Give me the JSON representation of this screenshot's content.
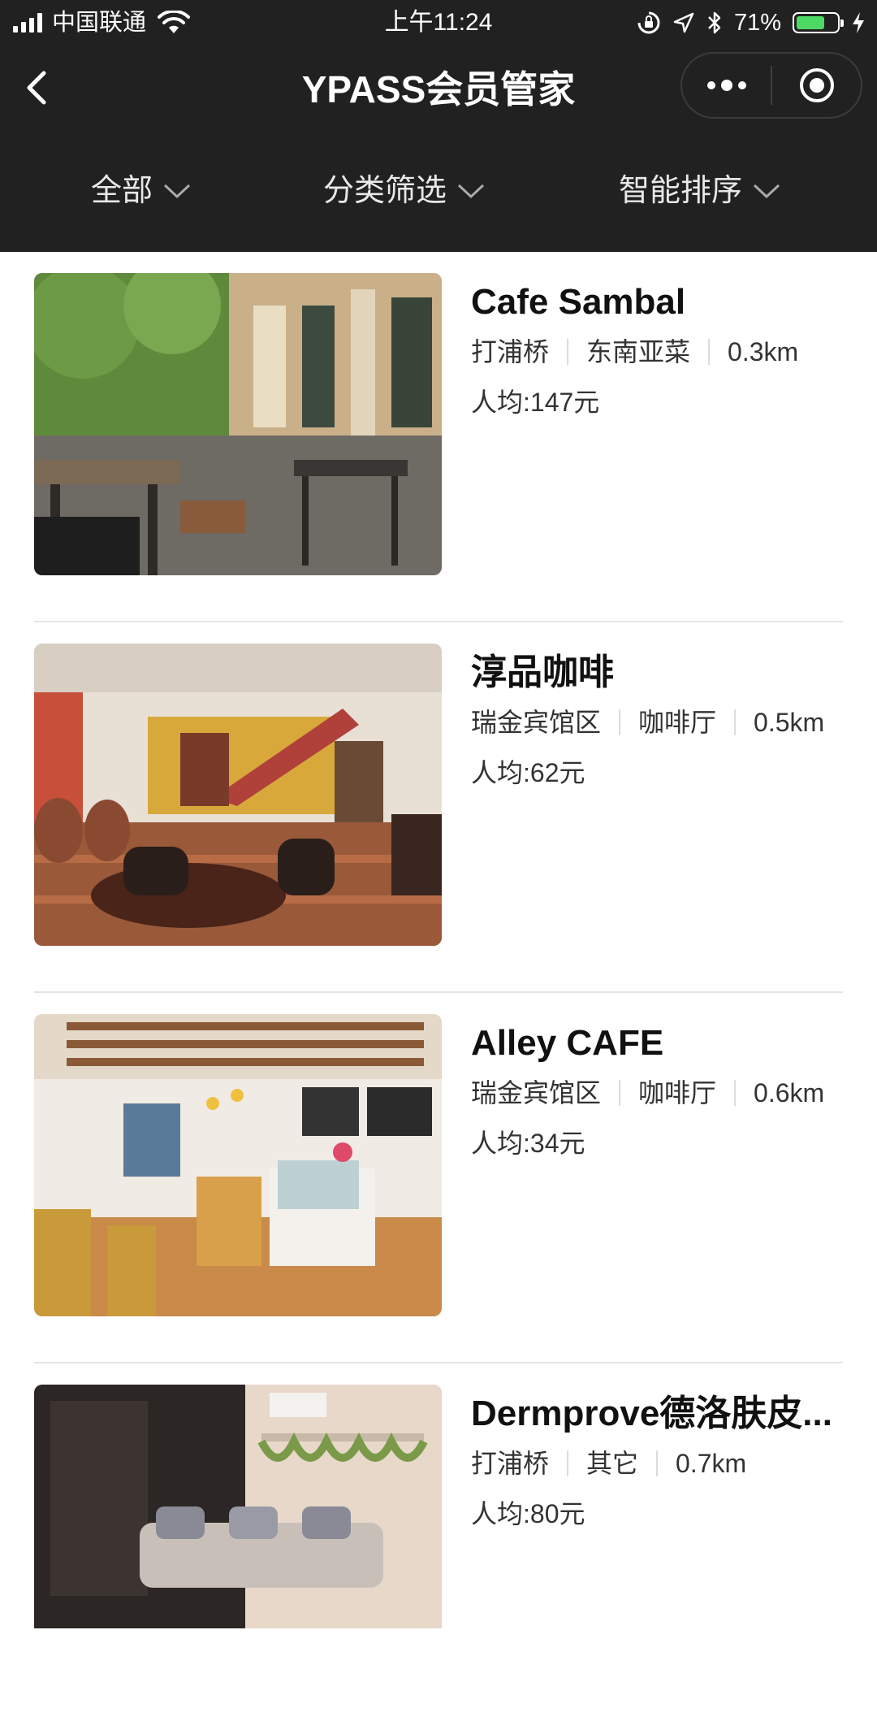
{
  "status": {
    "carrier": "中国联通",
    "time": "上午11:24",
    "battery_text": "71%",
    "battery_level": 0.71,
    "battery_color": "#4cd964"
  },
  "nav": {
    "back_icon": "chevron-left-icon",
    "title": "YPASS会员管家",
    "more_icon": "more-dots-icon",
    "close_icon": "target-circle-icon"
  },
  "filters": [
    {
      "label": "全部"
    },
    {
      "label": "分类筛选"
    },
    {
      "label": "智能排序"
    }
  ],
  "shops": [
    {
      "name": "Cafe Sambal",
      "area": "打浦桥",
      "category": "东南亚菜",
      "distance": "0.3km",
      "price": "人均:147元"
    },
    {
      "name": "淳品咖啡",
      "area": "瑞金宾馆区",
      "category": "咖啡厅",
      "distance": "0.5km",
      "price": "人均:62元"
    },
    {
      "name": "Alley CAFE",
      "area": "瑞金宾馆区",
      "category": "咖啡厅",
      "distance": "0.6km",
      "price": "人均:34元"
    },
    {
      "name": "Dermprove德洛肤皮...",
      "area": "打浦桥",
      "category": "其它",
      "distance": "0.7km",
      "price": "人均:80元"
    }
  ],
  "colors": {
    "header_bg": "#212121",
    "divider": "#e5e5e5"
  }
}
